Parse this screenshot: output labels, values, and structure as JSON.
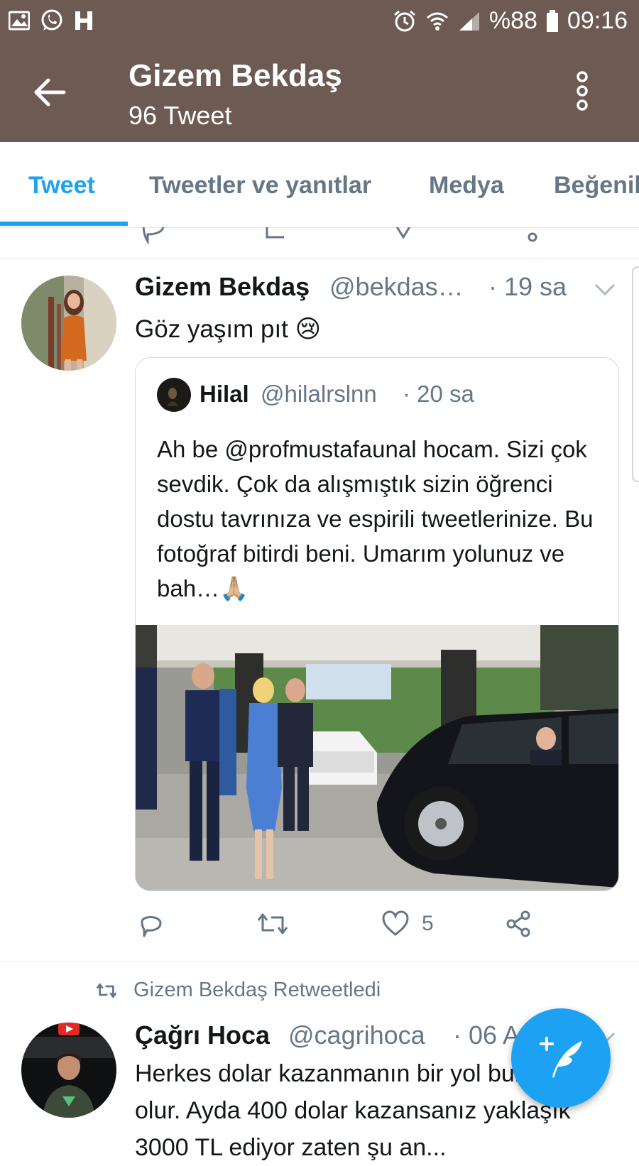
{
  "status_bar": {
    "battery": "%88",
    "time": "09:16",
    "icons": [
      "gallery-icon",
      "whatsapp-icon",
      "h-app-icon",
      "alarm-icon",
      "wifi-icon",
      "signal-icon",
      "battery-icon"
    ]
  },
  "header": {
    "title": "Gizem Bekdaş",
    "subtitle": "96 Tweet"
  },
  "tabs": [
    "Tweet",
    "Tweetler ve yanıtlar",
    "Medya",
    "Beğeniler"
  ],
  "active_tab": "Tweet",
  "tweets": [
    {
      "name": "Gizem Bekdaş",
      "handle": "@bekdas…",
      "time": "· 19 sa",
      "text": "Göz yaşım pıt 😢",
      "quote": {
        "name": "Hilal",
        "handle": "@hilalrslnn",
        "time": "· 20 sa",
        "text": "Ah be @profmustafaunal hocam. Sizi çok sevdik. Çok da alışmıştık sizin öğrenci dostu tavrınıza ve espirili tweetlerinize. Bu fotoğraf bitirdi beni. Umarım yolunuz ve bah…🙏🏼"
      },
      "likes": "5"
    },
    {
      "retweeted_by": "Gizem Bekdaş Retweetledi",
      "name": "Çağrı Hoca",
      "handle": "@cagrihoca",
      "time": "· 06 A",
      "text": "Herkes dolar kazanmanın bir yol bulsa iyi olur. Ayda 400 dolar kazansanız yaklaşık 3000 TL ediyor zaten şu an..."
    }
  ],
  "colors": {
    "header_bg": "#6d5a52",
    "accent": "#1da1f2",
    "muted": "#657786"
  }
}
